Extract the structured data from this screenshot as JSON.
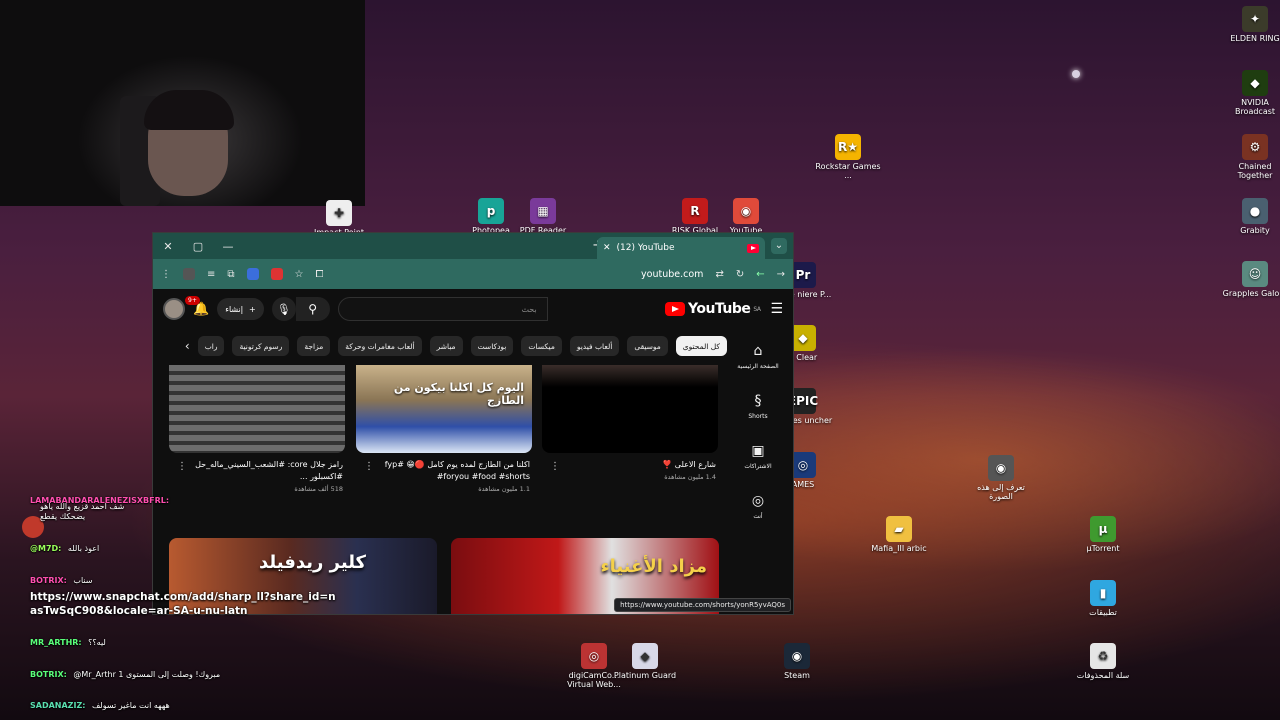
{
  "desktop_icons": [
    {
      "id": "elden",
      "label": "ELDEN RING",
      "color": "#3b3b2a",
      "glyph": "✦"
    },
    {
      "id": "nvidia",
      "label": "NVIDIA Broadcast",
      "color": "#1f3d10",
      "glyph": "◆"
    },
    {
      "id": "rockstar",
      "label": "Rockstar Games ...",
      "color": "#f5b400",
      "glyph": "R★"
    },
    {
      "id": "chained",
      "label": "Chained Together",
      "color": "#7a3222",
      "glyph": "⚙"
    },
    {
      "id": "grabity",
      "label": "Grabity",
      "color": "#4a6070",
      "glyph": "●"
    },
    {
      "id": "grapples",
      "label": "Grapples Galore",
      "color": "#5a8a80",
      "glyph": "☺"
    },
    {
      "id": "clear",
      "label": "e Clear",
      "color": "#c8b000",
      "glyph": "◆"
    },
    {
      "id": "epic",
      "label": "Games uncher",
      "color": "#222222",
      "glyph": "EPIC"
    },
    {
      "id": "ames",
      "label": "AMES",
      "color": "#1a3a7a",
      "glyph": "◎"
    },
    {
      "id": "dobe",
      "label": "dobe niere P...",
      "color": "#1c1a4a",
      "glyph": "Pr"
    },
    {
      "id": "lens",
      "label": "تعرف إلى هذه الصورة",
      "color": "#555555",
      "glyph": "◉"
    },
    {
      "id": "mafia",
      "label": "Mafia_III arbic",
      "color": "#f0c040",
      "glyph": "▰"
    },
    {
      "id": "utorrent",
      "label": "µTorrent",
      "color": "#3f9a2f",
      "glyph": "µ"
    },
    {
      "id": "apps",
      "label": "تطبيقات",
      "color": "#2fa7e0",
      "glyph": "▮"
    },
    {
      "id": "recycle",
      "label": "سلة المحذوفات",
      "color": "#e6e6e6",
      "glyph": "♻"
    },
    {
      "id": "digicam",
      "label": "digiCamCo... Virtual Web...",
      "color": "#b33",
      "glyph": "◎"
    },
    {
      "id": "platinum",
      "label": "Platinum Guard",
      "color": "#d8d8e8",
      "glyph": "◆"
    },
    {
      "id": "steam",
      "label": "Steam",
      "color": "#1b2838",
      "glyph": "◉"
    },
    {
      "id": "impact",
      "label": "Impact Point",
      "color": "#eeeeee",
      "glyph": "✚"
    },
    {
      "id": "photopea",
      "label": "Photopea",
      "color": "#18a497",
      "glyph": "p"
    },
    {
      "id": "pdf",
      "label": "PDF Reader",
      "color": "#7a3a9a",
      "glyph": "▦"
    },
    {
      "id": "risk",
      "label": "RISK Global",
      "color": "#c21b1b",
      "glyph": "R"
    },
    {
      "id": "chrome",
      "label": "YouTube",
      "color": "#e04a3a",
      "glyph": "◉"
    }
  ],
  "browser": {
    "tab_title": "(12) YouTube",
    "url": "youtube.com",
    "new_tab": "+",
    "window_controls": {
      "close": "✕",
      "maximize": "▢",
      "minimize": "—"
    },
    "status_url": "https://www.youtube.com/shorts/yonR5yvAQ0s"
  },
  "youtube": {
    "brand": "YouTube",
    "region": "SA",
    "search_placeholder": "بحث",
    "create_label": "إنشاء",
    "notif_count": "9+",
    "chips": [
      "كل المحتوى",
      "موسيقى",
      "ألعاب فيديو",
      "ميكسات",
      "بودكاست",
      "مباشر",
      "ألعاب مغامرات وحركة",
      "مزاجة",
      "رسوم كرتونية",
      "راب"
    ],
    "sidebar": [
      {
        "label": "الصفحة الرئيسية",
        "icon": "home-icon",
        "glyph": "⌂"
      },
      {
        "label": "Shorts",
        "icon": "shorts-icon",
        "glyph": "§"
      },
      {
        "label": "الاشتراكات",
        "icon": "subscriptions-icon",
        "glyph": "▣"
      },
      {
        "label": "أنت",
        "icon": "you-icon",
        "glyph": "◎"
      }
    ],
    "videos": [
      {
        "title": "شارع الاعلى ❣️",
        "meta": "1.4 مليون مشاهدة",
        "overlay": ""
      },
      {
        "title": "اكلنا من الطازج لمده يوم كامل 🔴😁 #fyp #foryou #food #shorts",
        "meta": "1.1 مليون مشاهدة",
        "overlay": "اليوم كل اكلنا بيكون من الطازج"
      },
      {
        "title": "رامز جلال core: #الشعب_السيني_ماله_حل #اكسبلور ...",
        "meta": "518 ألف مشاهدة",
        "overlay": ""
      }
    ],
    "row2": [
      {
        "label": "مزاد الأغنياء"
      },
      {
        "label": "كلير ريدفيلد"
      }
    ]
  },
  "chat": [
    {
      "user": "LAMABANDARALENEZISXBFRL:",
      "msg": "يضحكك يقطع",
      "color": "#ff4fb0"
    },
    {
      "user": "@M7D:",
      "msg": "اعوذ بالله",
      "color": "#9aff5a"
    },
    {
      "user": "BOTRIX:",
      "msg": "سناب",
      "color": "#ff4fb0"
    },
    {
      "user": "MR_ARTHR:",
      "msg": "ليه؟؟",
      "color": "#5aff7a"
    },
    {
      "user": "BOTRIX:",
      "msg": "@Mr_Arthr مبروك! وصلت إلى المستوى 1",
      "color": "#5aff7a"
    },
    {
      "user": "SADANAZIZ:",
      "msg": "هههه انت ماغير تسولف",
      "color": "#5adfb0"
    }
  ],
  "chat_big_message": "https://www.snapchat.com/add/sharp_ll?share_id=nasTwSqC908&locale=ar-SA-u-nu-latn",
  "chat_reply_text": "شف احمد قزيع والله ياهو"
}
